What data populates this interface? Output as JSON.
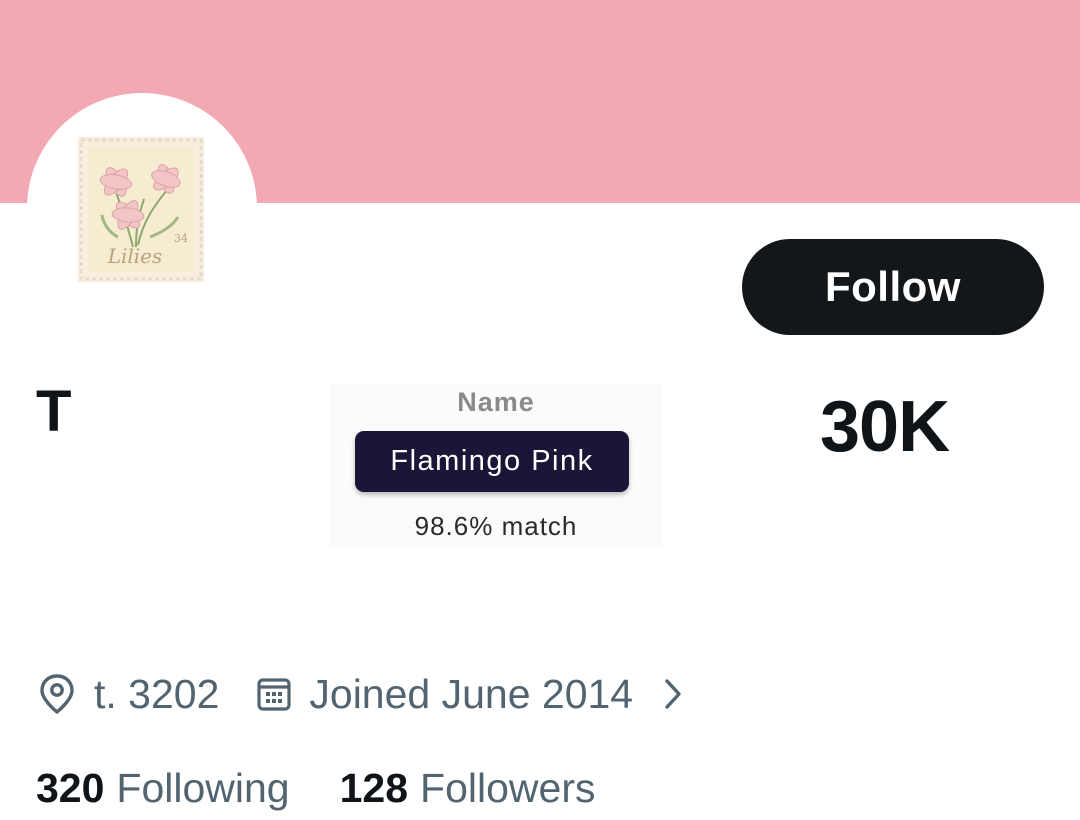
{
  "colors": {
    "banner": "#f3a9b4",
    "button_bg": "#14171a",
    "chip_bg": "#1b1538",
    "secondary_text": "#536471"
  },
  "profile": {
    "avatar_text": "Lilies",
    "avatar_number": "34",
    "display_name": "T",
    "follow_label": "Follow",
    "count": "30K"
  },
  "color_match": {
    "label": "Name",
    "color_name": "Flamingo Pink",
    "match": "98.6% match"
  },
  "meta": {
    "location_icon": "map-pin-icon",
    "location": "t. 3202",
    "calendar_icon": "calendar-icon",
    "joined": "Joined June 2014",
    "chevron_icon": "chevron-right-icon"
  },
  "stats": {
    "following_count": "320",
    "following_label": "Following",
    "followers_count": "128",
    "followers_label": "Followers"
  }
}
